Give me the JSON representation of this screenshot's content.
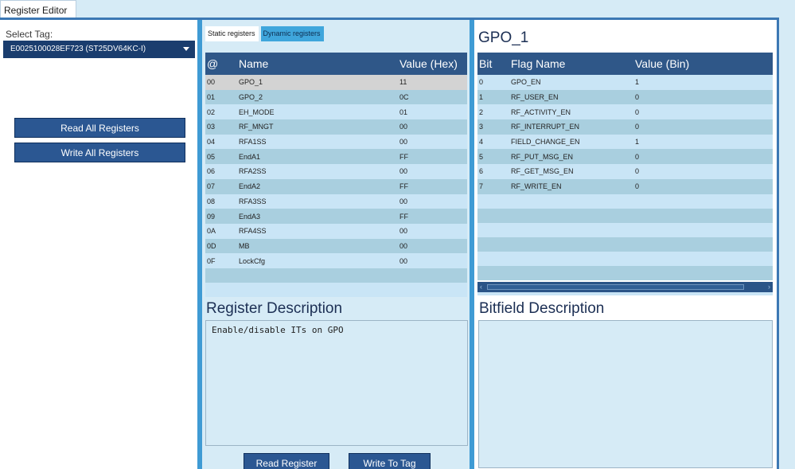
{
  "document_tab": {
    "label": "Register Editor",
    "close": "×"
  },
  "left": {
    "select_label": "Select Tag:",
    "selected_tag": "E0025100028EF723 (ST25DV64KC-I)",
    "read_all_label": "Read All Registers",
    "write_all_label": "Write All Registers"
  },
  "middle": {
    "tabs": [
      "Static registers",
      "Dynamic registers"
    ],
    "columns": [
      "@",
      "Name",
      "Value (Hex)"
    ],
    "rows": [
      [
        "00",
        "GPO_1",
        "11"
      ],
      [
        "01",
        "GPO_2",
        "0C"
      ],
      [
        "02",
        "EH_MODE",
        "01"
      ],
      [
        "03",
        "RF_MNGT",
        "00"
      ],
      [
        "04",
        "RFA1SS",
        "00"
      ],
      [
        "05",
        "EndA1",
        "FF"
      ],
      [
        "06",
        "RFA2SS",
        "00"
      ],
      [
        "07",
        "EndA2",
        "FF"
      ],
      [
        "08",
        "RFA3SS",
        "00"
      ],
      [
        "09",
        "EndA3",
        "FF"
      ],
      [
        "0A",
        "RFA4SS",
        "00"
      ],
      [
        "0D",
        "MB",
        "00"
      ],
      [
        "0F",
        "LockCfg",
        "00"
      ]
    ],
    "desc_title": "Register Description",
    "description": "Enable/disable ITs on GPO",
    "read_register_label": "Read Register",
    "write_to_tag_label": "Write To Tag"
  },
  "right": {
    "title": "GPO_1",
    "columns": [
      "Bit",
      "Flag Name",
      "Value (Bin)"
    ],
    "rows": [
      [
        "0",
        "GPO_EN",
        "1"
      ],
      [
        "1",
        "RF_USER_EN",
        "0"
      ],
      [
        "2",
        "RF_ACTIVITY_EN",
        "0"
      ],
      [
        "3",
        "RF_INTERRUPT_EN",
        "0"
      ],
      [
        "4",
        "FIELD_CHANGE_EN",
        "1"
      ],
      [
        "5",
        "RF_PUT_MSG_EN",
        "0"
      ],
      [
        "6",
        "RF_GET_MSG_EN",
        "0"
      ],
      [
        "7",
        "RF_WRITE_EN",
        "0"
      ]
    ],
    "desc_title": "Bitfield Description",
    "description": ""
  },
  "colors": {
    "header": "#2f5788",
    "button": "#2b5792",
    "accent": "#3f9bd4",
    "selected_row": "#d3d3d3"
  }
}
